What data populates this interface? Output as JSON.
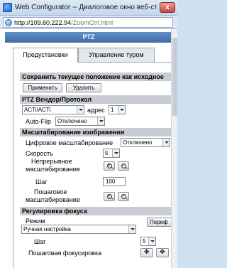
{
  "window": {
    "title": "Web Configurator -- Диалоговое окно веб-страницы",
    "close_label": "x"
  },
  "address": {
    "host": "http://109.60.222.94",
    "path": "/ZoomCtrl.html"
  },
  "header": {
    "title": "PTZ"
  },
  "tabs": [
    {
      "label": "Предустановки",
      "active": true
    },
    {
      "label": "Управление туром",
      "active": false
    }
  ],
  "save_position": {
    "section": "Сохранить текущее положение как исходное",
    "apply_label": "Применить",
    "delete_label": "Удалить"
  },
  "vendor": {
    "section": "PTZ Вендор/Протокол",
    "protocol_value": "ACTi/ACTi",
    "address_label": "адрес",
    "address_value": "1",
    "autoflip_label": "Auto-Flip",
    "autoflip_value": "Отключено"
  },
  "zoom": {
    "section": "Масштабирование изображения",
    "digital_label": "Цифровое масштабирование",
    "digital_value": "Отключено",
    "speed_label": "Скорость",
    "speed_value": "5",
    "continuous_label_1": "Непрерывное",
    "continuous_label_2": "масштабирование",
    "step_label": "Шаг",
    "step_value": "100",
    "stepwise_label_1": "Пошаговое",
    "stepwise_label_2": "масштабирование"
  },
  "focus": {
    "section": "Регулировка фокуса",
    "mode_label": "Режим",
    "mode_value": "Ручная настройка",
    "mode_button": "Переф",
    "step_label": "Шаг",
    "step_value": "5",
    "stepwise_label": "Пошаговая фокусировка"
  }
}
